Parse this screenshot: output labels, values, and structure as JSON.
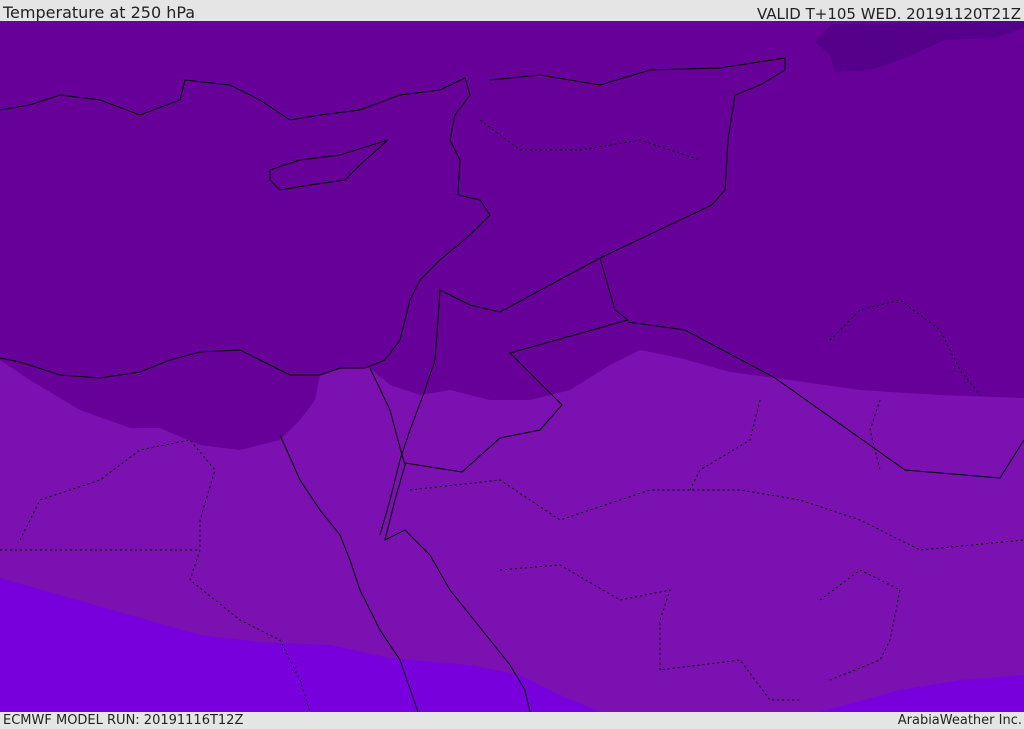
{
  "header": {
    "title": "Temperature at 250 hPa",
    "valid": "VALID T+105 WED. 20191120T21Z"
  },
  "footer": {
    "model_run": "ECMWF MODEL RUN: 20191116T12Z",
    "credit": "ArabiaWeather Inc."
  },
  "colors": {
    "darkest": "#55008a",
    "dark": "#660099",
    "mid": "#7a11b0",
    "bright": "#7700dd",
    "background": "#e5e5e5"
  }
}
